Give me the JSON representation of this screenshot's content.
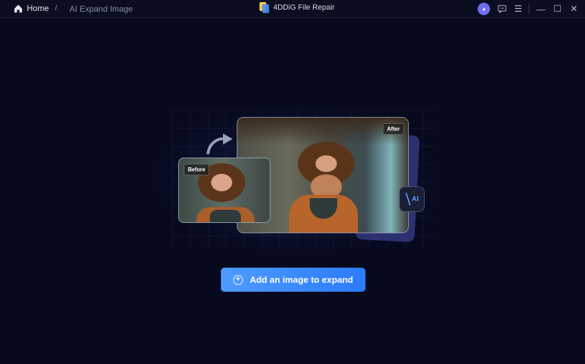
{
  "titlebar": {
    "home_label": "Home",
    "separator": "/",
    "breadcrumb_current": "AI Expand Image",
    "app_title": "4DDiG File Repair"
  },
  "preview": {
    "before_label": "Before",
    "after_label": "After",
    "ai_badge": "AI"
  },
  "main": {
    "add_button_label": "Add an image to expand"
  },
  "colors": {
    "background": "#070a1e",
    "accent": "#2b7bfa"
  }
}
